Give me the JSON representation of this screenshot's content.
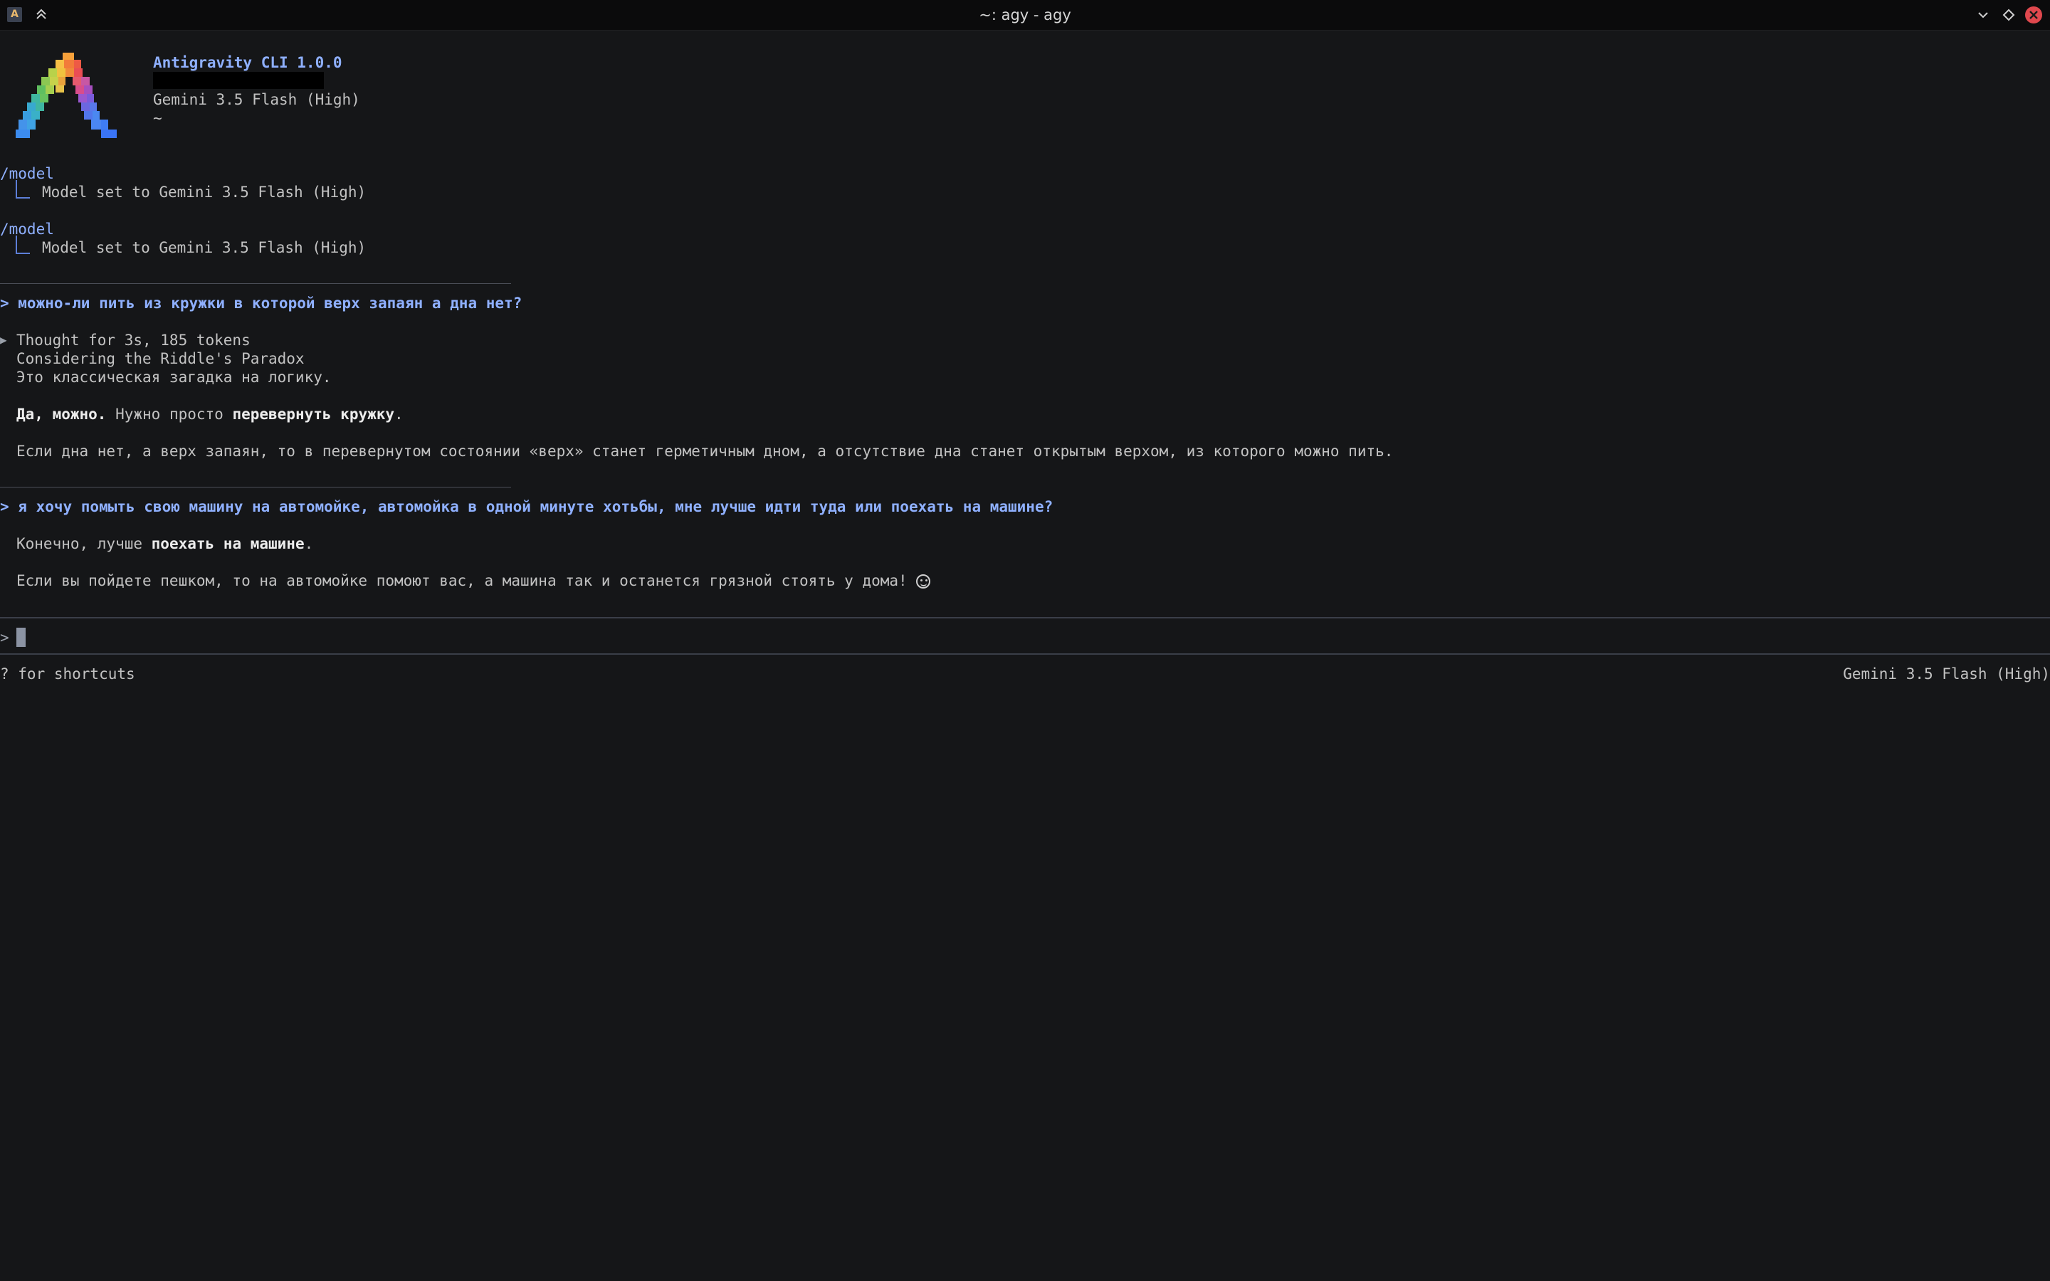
{
  "window": {
    "title": "~: agy - agy",
    "app_icon_letter": "A"
  },
  "header": {
    "app_name": "Antigravity CLI 1.0.0",
    "model": "Gemini 3.5 Flash (High)",
    "cwd": "~"
  },
  "history": [
    {
      "command": "/model",
      "result": "Model set to Gemini 3.5 Flash (High)"
    },
    {
      "command": "/model",
      "result": "Model set to Gemini 3.5 Flash (High)"
    }
  ],
  "conversation": {
    "q1": {
      "prompt": "> можно-ли пить из кружки в которой верх запаян а дна нет?",
      "thought_arrow": "▶",
      "thought_summary": "Thought for 3s, 185 tokens",
      "thought_title": "Considering the Riddle's Paradox",
      "thought_text": "Это классическая загадка на логику.",
      "answer_bold1": "Да, можно.",
      "answer_mid": " Нужно просто ",
      "answer_bold2": "перевернуть кружку",
      "answer_end": ".",
      "answer_para2": "Если дна нет, а верх запаян, то в перевернутом состоянии «верх» станет герметичным дном, а отсутствие дна станет открытым верхом, из которого можно пить."
    },
    "q2": {
      "prompt": "> я хочу помыть свою машину на автомойке, автомойка в одной минуте хотьбы, мне лучше идти туда или поехать на машине?",
      "answer_pre": "Конечно, лучше ",
      "answer_bold": "поехать на машине",
      "answer_end": ".",
      "answer_para2": "Если вы пойдете пешком, то на автомойке помоют вас, а машина так и останется грязной стоять у дома! "
    }
  },
  "input": {
    "prompt_symbol": ">",
    "value": ""
  },
  "footer": {
    "hint": "? for shortcuts",
    "model": "Gemini 3.5 Flash (High)"
  },
  "colors": {
    "background": "#151618",
    "accent_blue": "#8fb0ff",
    "close_button": "#e0484e"
  }
}
